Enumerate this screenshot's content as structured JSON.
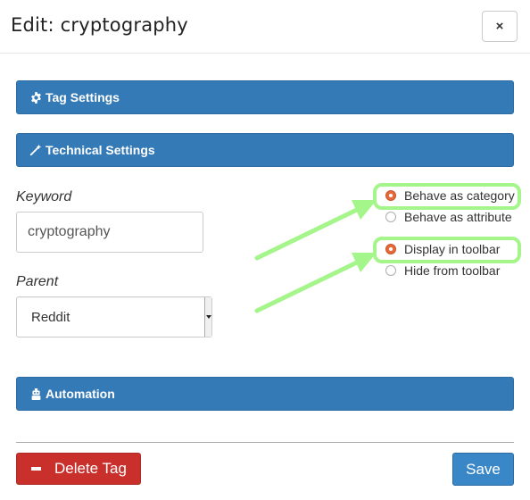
{
  "header": {
    "title": "Edit: cryptography",
    "close_label": "×"
  },
  "panels": {
    "tag_settings": {
      "label": "Tag Settings",
      "icon": "gear-icon"
    },
    "technical_settings": {
      "label": "Technical Settings",
      "icon": "magic-wand-icon"
    },
    "automation": {
      "label": "Automation",
      "icon": "robot-icon"
    }
  },
  "form": {
    "keyword": {
      "label": "Keyword",
      "value": "cryptography"
    },
    "parent": {
      "label": "Parent",
      "selected": "Reddit"
    }
  },
  "radios": {
    "behave_group": [
      {
        "label": "Behave as category",
        "checked": true
      },
      {
        "label": "Behave as attribute",
        "checked": false
      }
    ],
    "toolbar_group": [
      {
        "label": "Display in toolbar",
        "checked": true
      },
      {
        "label": "Hide from toolbar",
        "checked": false
      }
    ]
  },
  "footer": {
    "delete_label": "Delete Tag",
    "save_label": "Save"
  },
  "colors": {
    "panel_blue": "#337ab7",
    "danger_red": "#c9302c",
    "radio_checked": "#e46a3b",
    "annotation_green": "#a4f58a"
  }
}
